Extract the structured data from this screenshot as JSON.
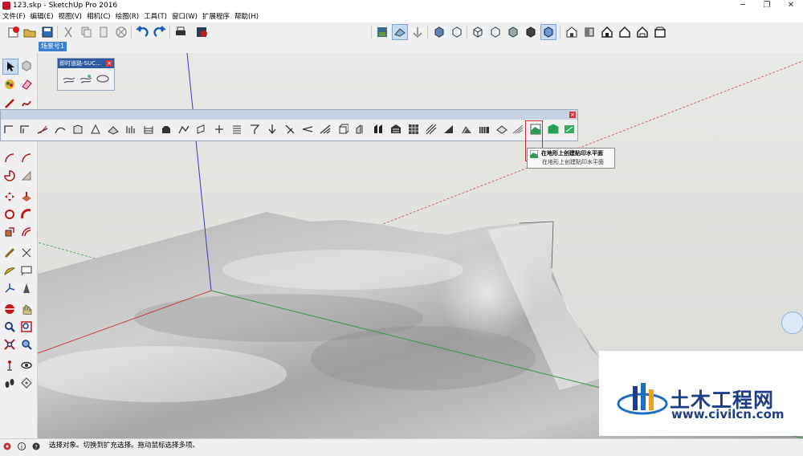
{
  "window": {
    "title": "123.skp - SketchUp Pro 2016",
    "controls": {
      "minimize": "─",
      "maximize": "❐",
      "close": "✕"
    }
  },
  "menu": [
    "文件(F)",
    "编辑(E)",
    "视图(V)",
    "相机(C)",
    "绘图(R)",
    "工具(T)",
    "窗口(W)",
    "扩展程序",
    "帮助(H)"
  ],
  "scene": {
    "tab_label": "场景号1"
  },
  "float_toolbar_small": {
    "title": "即时道路-SUC..."
  },
  "tooltip": {
    "title": "在地形上创建贴印水平面",
    "description": "在地形上创建贴印水平面"
  },
  "status": {
    "text": "选择对象。切换到扩充选择。拖动鼠标选择多项。"
  },
  "watermark": {
    "name": "土木工程网",
    "url": "www.civilcn.com"
  },
  "colors": {
    "axis_red": "#c83a3a",
    "axis_green": "#2f9a3a",
    "axis_blue": "#3a3ac8",
    "accent": "#3b7fd0",
    "highlight": "#d92a2a"
  }
}
